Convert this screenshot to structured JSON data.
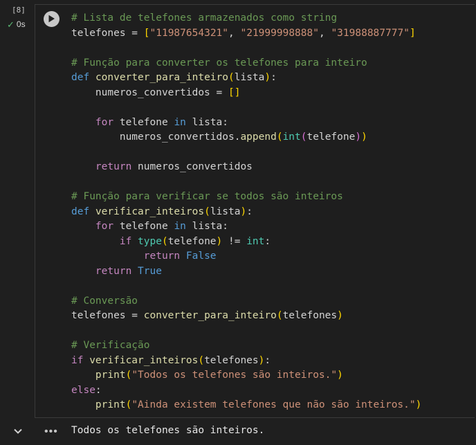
{
  "cell": {
    "execution_count": "[8]",
    "duration": "0s",
    "status_icon": "check-icon",
    "run_icon": "play-icon"
  },
  "code_lines": [
    [
      {
        "t": "# Lista de telefones armazenados como string",
        "c": "cm"
      }
    ],
    [
      {
        "t": "telefones",
        "c": "var"
      },
      {
        "t": " = ",
        "c": "var"
      },
      {
        "t": "[",
        "c": "b1"
      },
      {
        "t": "\"11987654321\"",
        "c": "str"
      },
      {
        "t": ", ",
        "c": "var"
      },
      {
        "t": "\"21999998888\"",
        "c": "str"
      },
      {
        "t": ", ",
        "c": "var"
      },
      {
        "t": "\"31988887777\"",
        "c": "str"
      },
      {
        "t": "]",
        "c": "b1"
      }
    ],
    [],
    [
      {
        "t": "# Função para converter os telefones para inteiro",
        "c": "cm"
      }
    ],
    [
      {
        "t": "def",
        "c": "kw"
      },
      {
        "t": " ",
        "c": "var"
      },
      {
        "t": "converter_para_inteiro",
        "c": "fn"
      },
      {
        "t": "(",
        "c": "b1"
      },
      {
        "t": "lista",
        "c": "var"
      },
      {
        "t": ")",
        "c": "b1"
      },
      {
        "t": ":",
        "c": "var"
      }
    ],
    [
      {
        "t": "    numeros_convertidos = ",
        "c": "var"
      },
      {
        "t": "[]",
        "c": "b1"
      }
    ],
    [],
    [
      {
        "t": "    ",
        "c": "var"
      },
      {
        "t": "for",
        "c": "ctl"
      },
      {
        "t": " telefone ",
        "c": "var"
      },
      {
        "t": "in",
        "c": "kw"
      },
      {
        "t": " lista:",
        "c": "var"
      }
    ],
    [
      {
        "t": "        numeros_convertidos.",
        "c": "var"
      },
      {
        "t": "append",
        "c": "fn"
      },
      {
        "t": "(",
        "c": "b1"
      },
      {
        "t": "int",
        "c": "bi"
      },
      {
        "t": "(",
        "c": "b2"
      },
      {
        "t": "telefone",
        "c": "var"
      },
      {
        "t": ")",
        "c": "b2"
      },
      {
        "t": ")",
        "c": "b1"
      }
    ],
    [],
    [
      {
        "t": "    ",
        "c": "var"
      },
      {
        "t": "return",
        "c": "ctl"
      },
      {
        "t": " numeros_convertidos",
        "c": "var"
      }
    ],
    [],
    [
      {
        "t": "# Função para verificar se todos são inteiros",
        "c": "cm"
      }
    ],
    [
      {
        "t": "def",
        "c": "kw"
      },
      {
        "t": " ",
        "c": "var"
      },
      {
        "t": "verificar_inteiros",
        "c": "fn"
      },
      {
        "t": "(",
        "c": "b1"
      },
      {
        "t": "lista",
        "c": "var"
      },
      {
        "t": ")",
        "c": "b1"
      },
      {
        "t": ":",
        "c": "var"
      }
    ],
    [
      {
        "t": "    ",
        "c": "var"
      },
      {
        "t": "for",
        "c": "ctl"
      },
      {
        "t": " telefone ",
        "c": "var"
      },
      {
        "t": "in",
        "c": "kw"
      },
      {
        "t": " lista:",
        "c": "var"
      }
    ],
    [
      {
        "t": "        ",
        "c": "var"
      },
      {
        "t": "if",
        "c": "ctl"
      },
      {
        "t": " ",
        "c": "var"
      },
      {
        "t": "type",
        "c": "bi"
      },
      {
        "t": "(",
        "c": "b1"
      },
      {
        "t": "telefone",
        "c": "var"
      },
      {
        "t": ")",
        "c": "b1"
      },
      {
        "t": " != ",
        "c": "var"
      },
      {
        "t": "int",
        "c": "bi"
      },
      {
        "t": ":",
        "c": "var"
      }
    ],
    [
      {
        "t": "            ",
        "c": "var"
      },
      {
        "t": "return",
        "c": "ctl"
      },
      {
        "t": " ",
        "c": "var"
      },
      {
        "t": "False",
        "c": "kw"
      }
    ],
    [
      {
        "t": "    ",
        "c": "var"
      },
      {
        "t": "return",
        "c": "ctl"
      },
      {
        "t": " ",
        "c": "var"
      },
      {
        "t": "True",
        "c": "kw"
      }
    ],
    [],
    [
      {
        "t": "# Conversão",
        "c": "cm"
      }
    ],
    [
      {
        "t": "telefones = ",
        "c": "var"
      },
      {
        "t": "converter_para_inteiro",
        "c": "fn"
      },
      {
        "t": "(",
        "c": "b1"
      },
      {
        "t": "telefones",
        "c": "var"
      },
      {
        "t": ")",
        "c": "b1"
      }
    ],
    [],
    [
      {
        "t": "# Verificação",
        "c": "cm"
      }
    ],
    [
      {
        "t": "if",
        "c": "ctl"
      },
      {
        "t": " ",
        "c": "var"
      },
      {
        "t": "verificar_inteiros",
        "c": "fn"
      },
      {
        "t": "(",
        "c": "b1"
      },
      {
        "t": "telefones",
        "c": "var"
      },
      {
        "t": ")",
        "c": "b1"
      },
      {
        "t": ":",
        "c": "var"
      }
    ],
    [
      {
        "t": "    ",
        "c": "var"
      },
      {
        "t": "print",
        "c": "fn"
      },
      {
        "t": "(",
        "c": "b1"
      },
      {
        "t": "\"Todos os telefones são inteiros.\"",
        "c": "str"
      },
      {
        "t": ")",
        "c": "b1"
      }
    ],
    [
      {
        "t": "else",
        "c": "ctl"
      },
      {
        "t": ":",
        "c": "var"
      }
    ],
    [
      {
        "t": "    ",
        "c": "var"
      },
      {
        "t": "print",
        "c": "fn"
      },
      {
        "t": "(",
        "c": "b1"
      },
      {
        "t": "\"Ainda existem telefones que não são inteiros.\"",
        "c": "str"
      },
      {
        "t": ")",
        "c": "b1"
      }
    ]
  ],
  "output": {
    "menu_icon": "more-horiz-icon",
    "text": "Todos os telefones são inteiros.",
    "collapse_icon": "chevron-down-icon"
  }
}
